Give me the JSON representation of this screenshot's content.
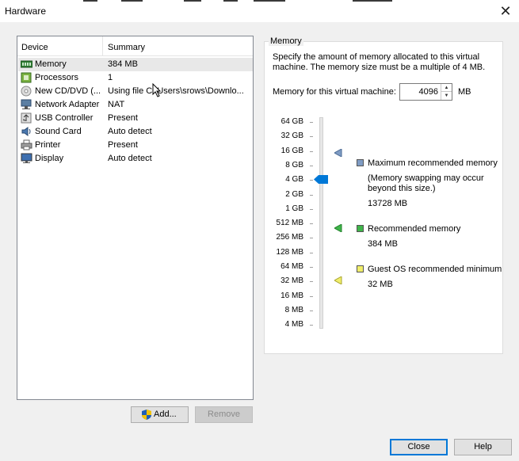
{
  "window": {
    "title": "Hardware"
  },
  "device_list": {
    "headers": {
      "device": "Device",
      "summary": "Summary"
    },
    "rows": [
      {
        "device": "Memory",
        "summary": "384 MB",
        "icon": "memory-icon",
        "selected": true
      },
      {
        "device": "Processors",
        "summary": "1",
        "icon": "processor-icon"
      },
      {
        "device": "New CD/DVD (...",
        "summary": "Using file C:\\Users\\srows\\Downlo...",
        "icon": "cd-dvd-icon"
      },
      {
        "device": "Network Adapter",
        "summary": "NAT",
        "icon": "network-adapter-icon"
      },
      {
        "device": "USB Controller",
        "summary": "Present",
        "icon": "usb-controller-icon"
      },
      {
        "device": "Sound Card",
        "summary": "Auto detect",
        "icon": "sound-card-icon"
      },
      {
        "device": "Printer",
        "summary": "Present",
        "icon": "printer-icon"
      },
      {
        "device": "Display",
        "summary": "Auto detect",
        "icon": "display-icon"
      }
    ]
  },
  "buttons": {
    "add": "Add...",
    "remove": "Remove",
    "close": "Close",
    "help": "Help"
  },
  "memory": {
    "group_title": "Memory",
    "description": "Specify the amount of memory allocated to this virtual machine. The memory size must be a multiple of 4 MB.",
    "field_label": "Memory for this virtual machine:",
    "value": "4096",
    "unit": "MB",
    "scale": [
      "64 GB",
      "32 GB",
      "16 GB",
      "8 GB",
      "4 GB",
      "2 GB",
      "1 GB",
      "512 MB",
      "256 MB",
      "128 MB",
      "64 MB",
      "32 MB",
      "16 MB",
      "8 MB",
      "4 MB"
    ],
    "selected_level": "4 GB",
    "legend": {
      "max": {
        "label": "Maximum recommended memory",
        "note": "(Memory swapping may occur beyond this size.)",
        "value": "13728 MB",
        "color": "#7f9cc4"
      },
      "recommended": {
        "label": "Recommended memory",
        "value": "384 MB",
        "color": "#3fb54a"
      },
      "guest_min": {
        "label": "Guest OS recommended minimum",
        "value": "32 MB",
        "color": "#f0ee6a"
      }
    }
  },
  "colors": {
    "accent": "#0078d7",
    "window_bg": "#f0f0f0",
    "desktop": "#5b9ea4"
  }
}
